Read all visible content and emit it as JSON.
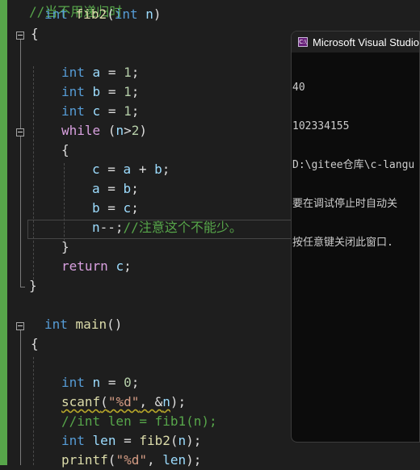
{
  "editor": {
    "lines": [
      {
        "id": "l0",
        "tokens": [
          [
            "cm",
            "//当不用递归时"
          ]
        ]
      },
      {
        "id": "l1",
        "tokens": [
          [
            "kw",
            "int"
          ],
          [
            "t",
            " "
          ],
          [
            "fn",
            "fib2"
          ],
          [
            "t",
            "("
          ],
          [
            "kw",
            "int"
          ],
          [
            "t",
            " "
          ],
          [
            "var",
            "n"
          ],
          [
            "t",
            ")"
          ]
        ]
      },
      {
        "id": "l2",
        "tokens": [
          [
            "t",
            "{"
          ]
        ]
      },
      {
        "id": "l3",
        "tokens": [
          [
            "t",
            ""
          ]
        ]
      },
      {
        "id": "l4",
        "tokens": [
          [
            "kw",
            "int"
          ],
          [
            "t",
            " "
          ],
          [
            "var",
            "a"
          ],
          [
            "t",
            " = "
          ],
          [
            "num",
            "1"
          ],
          [
            "t",
            ";"
          ]
        ]
      },
      {
        "id": "l5",
        "tokens": [
          [
            "kw",
            "int"
          ],
          [
            "t",
            " "
          ],
          [
            "var",
            "b"
          ],
          [
            "t",
            " = "
          ],
          [
            "num",
            "1"
          ],
          [
            "t",
            ";"
          ]
        ]
      },
      {
        "id": "l6",
        "tokens": [
          [
            "kw",
            "int"
          ],
          [
            "t",
            " "
          ],
          [
            "var",
            "c"
          ],
          [
            "t",
            " = "
          ],
          [
            "num",
            "1"
          ],
          [
            "t",
            ";"
          ]
        ]
      },
      {
        "id": "l7",
        "tokens": [
          [
            "ctl",
            "while"
          ],
          [
            "t",
            " ("
          ],
          [
            "var",
            "n"
          ],
          [
            "t",
            ">"
          ],
          [
            "num",
            "2"
          ],
          [
            "t",
            ")"
          ]
        ]
      },
      {
        "id": "l8",
        "tokens": [
          [
            "t",
            "{"
          ]
        ]
      },
      {
        "id": "l9",
        "tokens": [
          [
            "var",
            "c"
          ],
          [
            "t",
            " = "
          ],
          [
            "var",
            "a"
          ],
          [
            "t",
            " + "
          ],
          [
            "var",
            "b"
          ],
          [
            "t",
            ";"
          ]
        ]
      },
      {
        "id": "l10",
        "tokens": [
          [
            "var",
            "a"
          ],
          [
            "t",
            " = "
          ],
          [
            "var",
            "b"
          ],
          [
            "t",
            ";"
          ]
        ]
      },
      {
        "id": "l11",
        "tokens": [
          [
            "var",
            "b"
          ],
          [
            "t",
            " = "
          ],
          [
            "var",
            "c"
          ],
          [
            "t",
            ";"
          ]
        ]
      },
      {
        "id": "l12",
        "tokens": [
          [
            "var",
            "n"
          ],
          [
            "t",
            "--;"
          ],
          [
            "cm",
            "//注意这个不能少。"
          ]
        ]
      },
      {
        "id": "l13",
        "tokens": [
          [
            "t",
            "}"
          ]
        ]
      },
      {
        "id": "l14",
        "tokens": [
          [
            "ctl",
            "return"
          ],
          [
            "t",
            " "
          ],
          [
            "var",
            "c"
          ],
          [
            "t",
            ";"
          ]
        ]
      },
      {
        "id": "l15",
        "tokens": [
          [
            "t",
            "}"
          ]
        ]
      },
      {
        "id": "l16",
        "tokens": [
          [
            "t",
            ""
          ]
        ]
      },
      {
        "id": "l17",
        "tokens": [
          [
            "kw",
            "int"
          ],
          [
            "t",
            " "
          ],
          [
            "fn",
            "main"
          ],
          [
            "t",
            "()"
          ]
        ]
      },
      {
        "id": "l18",
        "tokens": [
          [
            "t",
            "{"
          ]
        ]
      },
      {
        "id": "l19",
        "tokens": [
          [
            "t",
            ""
          ]
        ]
      },
      {
        "id": "l20",
        "tokens": [
          [
            "kw",
            "int"
          ],
          [
            "t",
            " "
          ],
          [
            "var",
            "n"
          ],
          [
            "t",
            " = "
          ],
          [
            "num",
            "0"
          ],
          [
            "t",
            ";"
          ]
        ]
      },
      {
        "id": "l21",
        "tokens": [
          [
            "fnsq",
            "scanf"
          ],
          [
            "tsq",
            "("
          ],
          [
            "strsq",
            "\"%d\""
          ],
          [
            "tsq",
            ", &"
          ],
          [
            "varsq",
            "n"
          ],
          [
            "t",
            ");"
          ]
        ]
      },
      {
        "id": "l22",
        "tokens": [
          [
            "cm",
            "//int len = fib1(n);"
          ]
        ]
      },
      {
        "id": "l23",
        "tokens": [
          [
            "kw",
            "int"
          ],
          [
            "t",
            " "
          ],
          [
            "var",
            "len"
          ],
          [
            "t",
            " = "
          ],
          [
            "fn",
            "fib2"
          ],
          [
            "t",
            "("
          ],
          [
            "var",
            "n"
          ],
          [
            "t",
            ");"
          ]
        ]
      },
      {
        "id": "l24",
        "tokens": [
          [
            "fn",
            "printf"
          ],
          [
            "t",
            "("
          ],
          [
            "str",
            "\"%d\""
          ],
          [
            "t",
            ", "
          ],
          [
            "var",
            "len"
          ],
          [
            "t",
            ");"
          ]
        ]
      }
    ]
  },
  "console": {
    "title": "Microsoft Visual Studio",
    "icon": "vs-console-icon",
    "output": [
      "40",
      "102334155",
      "D:\\gitee仓库\\c-langu",
      "要在调试停止时自动关",
      "按任意键关闭此窗口."
    ]
  },
  "colors": {
    "keyword": "#569cd6",
    "function": "#dcdcaa",
    "variable": "#9cdcfe",
    "number": "#b5cea8",
    "string": "#d69d85",
    "comment": "#57a64a",
    "control": "#d8a0df",
    "change_bar": "#57a64a",
    "background": "#1e1e1e"
  }
}
